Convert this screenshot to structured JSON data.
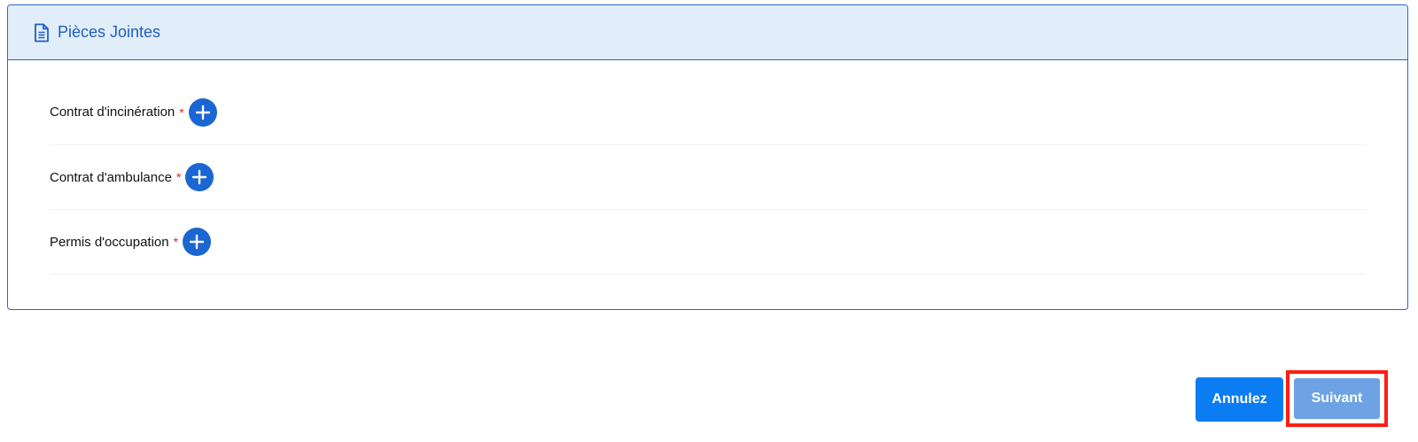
{
  "attachments": {
    "title": "Pièces Jointes",
    "header_icon": "document-icon",
    "required_marker": "*",
    "items": [
      {
        "label": "Contrat d'incinération",
        "action_icon": "plus-circle-icon"
      },
      {
        "label": "Contrat d'ambulance",
        "action_icon": "plus-circle-icon"
      },
      {
        "label": "Permis d'occupation",
        "action_icon": "plus-circle-icon"
      }
    ]
  },
  "footer": {
    "cancel_label": "Annulez",
    "next_label": "Suivant"
  },
  "colors": {
    "accent": "#1a66d2",
    "header_bg": "#e1edf9",
    "required": "#e0242b",
    "cancel_bg": "#0c7cf3",
    "next_bg": "#6da2e4",
    "highlight": "#ff1e12"
  }
}
